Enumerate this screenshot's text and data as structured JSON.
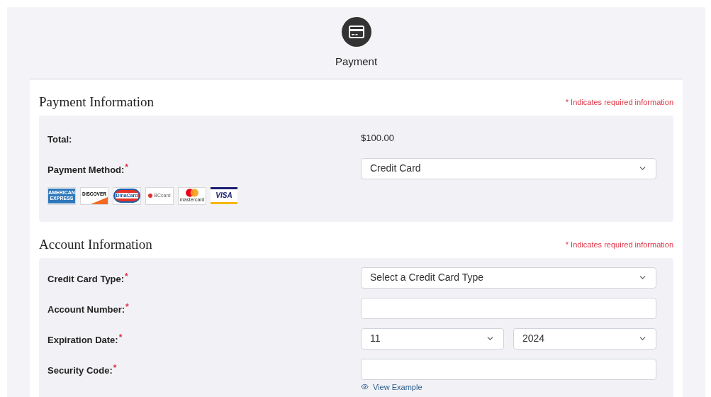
{
  "header": {
    "title": "Payment"
  },
  "payment_section": {
    "title": "Payment Information",
    "required_note": "* Indicates required information",
    "fields": [
      {
        "kind": "text",
        "label": "Total:",
        "value": "$100.00"
      },
      {
        "kind": "select",
        "label": "Payment Method:",
        "required_mark": "*",
        "value": "Credit Card"
      }
    ],
    "card_logos": [
      {
        "kind": "amex",
        "text": [
          "AMERICAN",
          "EXPRESS"
        ]
      },
      {
        "kind": "discover",
        "text": [
          "DISCOVER"
        ]
      },
      {
        "kind": "dinacard",
        "text": [
          "DinaCard"
        ]
      },
      {
        "kind": "bccard",
        "text": [
          "BCcard"
        ]
      },
      {
        "kind": "mastercard",
        "text": [
          "mastercard"
        ]
      },
      {
        "kind": "visa",
        "text": [
          "VISA"
        ]
      }
    ]
  },
  "account_section": {
    "title": "Account Information",
    "required_note": "* Indicates required information",
    "fields": [
      {
        "kind": "select",
        "label": "Credit Card Type:",
        "required_mark": "*",
        "value": "Select a Credit Card Type"
      },
      {
        "kind": "input",
        "label": "Account Number:",
        "required_mark": "*"
      },
      {
        "kind": "select_pair",
        "label": "Expiration Date:",
        "required_mark": "*",
        "values": [
          "11",
          "2024"
        ]
      },
      {
        "kind": "input",
        "label": "Security Code:",
        "required_mark": "*",
        "link": "View Example"
      }
    ]
  }
}
